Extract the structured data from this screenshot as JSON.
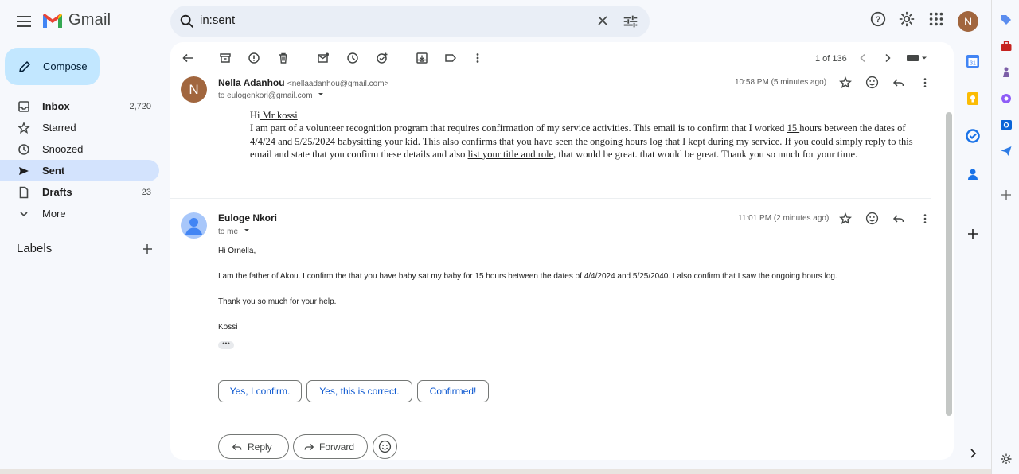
{
  "app": {
    "name": "Gmail"
  },
  "search": {
    "value": "in:sent"
  },
  "account": {
    "initial": "N"
  },
  "compose": {
    "label": "Compose"
  },
  "nav": [
    {
      "label": "Inbox",
      "count": "2,720",
      "bold": true
    },
    {
      "label": "Starred",
      "count": ""
    },
    {
      "label": "Snoozed",
      "count": ""
    },
    {
      "label": "Sent",
      "count": "",
      "bold": true,
      "active": true
    },
    {
      "label": "Drafts",
      "count": "23",
      "bold": true
    },
    {
      "label": "More",
      "count": ""
    }
  ],
  "labels": {
    "title": "Labels"
  },
  "pager": {
    "text": "1 of 136"
  },
  "messages": [
    {
      "avatar": "N",
      "avatar_color": "#a1663e",
      "sender": "Nella Adanhou",
      "email": "<nellaadanhou@gmail.com>",
      "to": "to eulogenkori@gmail.com",
      "time": "10:58 PM (5 minutes ago)",
      "body": {
        "greeting_a": "Hi",
        "greeting_b": " Mr kossi",
        "p1": "I am part of a volunteer recognition program that requires confirmation of my service activities. This email is to confirm that I worked ",
        "hours": "15 ",
        "p2": "hours between the dates of 4/4/24 and 5/25/2024 babysitting your kid. This also confirms that you have seen the ongoing hours log that I kept during my service. If you could simply reply to this email and state that you confirm these details and also ",
        "link": "list your title and role",
        "p3": ", that would be great. that would be great. Thank you so much for your time."
      }
    },
    {
      "sender": "Euloge Nkori",
      "to": "to me",
      "time": "11:01 PM (2 minutes ago)",
      "body": {
        "line1": "Hi Ornella,",
        "line2": "I am the father of Akou. I confirm the that you have baby sat my baby for 15 hours between the dates of 4/4/2024 and 5/25/2040. I also confirm that I saw the ongoing hours log.",
        "line3": "Thank you so much for your help.",
        "line4": "Kossi"
      }
    }
  ],
  "smart_replies": [
    "Yes, I confirm.",
    "Yes, this is correct.",
    "Confirmed!"
  ],
  "actions": {
    "reply": "Reply",
    "forward": "Forward"
  }
}
